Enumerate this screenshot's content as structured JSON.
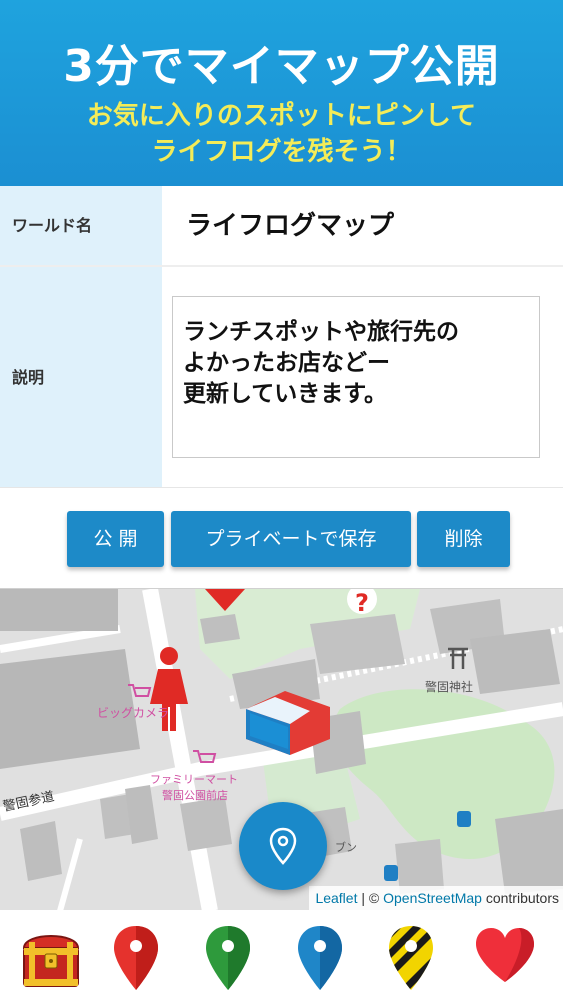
{
  "header": {
    "title": "3分でマイマップ公開",
    "subtitle_line1": "お気に入りのスポットにピンして",
    "subtitle_line2": "ライフログを残そう！"
  },
  "form": {
    "world_name_label": "ワールド名",
    "world_name_value": "ライフログマップ",
    "description_label": "説明",
    "description_value": "ランチスポットや旅行先の\nよかったお店などー\n更新していきます。"
  },
  "buttons": {
    "publish": "公 開",
    "save_private": "プライベートで保存",
    "delete": "削除"
  },
  "map": {
    "labels": {
      "store1": "ビッグカメラ",
      "store2_line1": "ファミリーマート",
      "store2_line2": "警固公園前店",
      "shrine": "警固神社",
      "street": "警固参道",
      "partial": "ブン"
    },
    "attribution": {
      "leaflet": "Leaflet",
      "separator": " | © ",
      "osm": "OpenStreetMap",
      "contributors": " contributors"
    },
    "fab_icon": "location-pin-icon"
  },
  "toolbar": {
    "items": [
      {
        "icon": "treasure-chest-icon",
        "color": "#c4261f"
      },
      {
        "icon": "red-pin-icon",
        "color": "#e5322d"
      },
      {
        "icon": "green-pin-icon",
        "color": "#2e9a3c"
      },
      {
        "icon": "blue-pin-icon",
        "color": "#1f86c8"
      },
      {
        "icon": "caution-striped-pin-icon",
        "color": "#f2d400"
      },
      {
        "icon": "heart-icon",
        "color": "#ef2f3a"
      }
    ]
  },
  "colors": {
    "accent": "#1d8ac8",
    "header_bg": "#1fa3de",
    "subtitle": "#f4ec58",
    "label_bg": "#dff1fb"
  }
}
